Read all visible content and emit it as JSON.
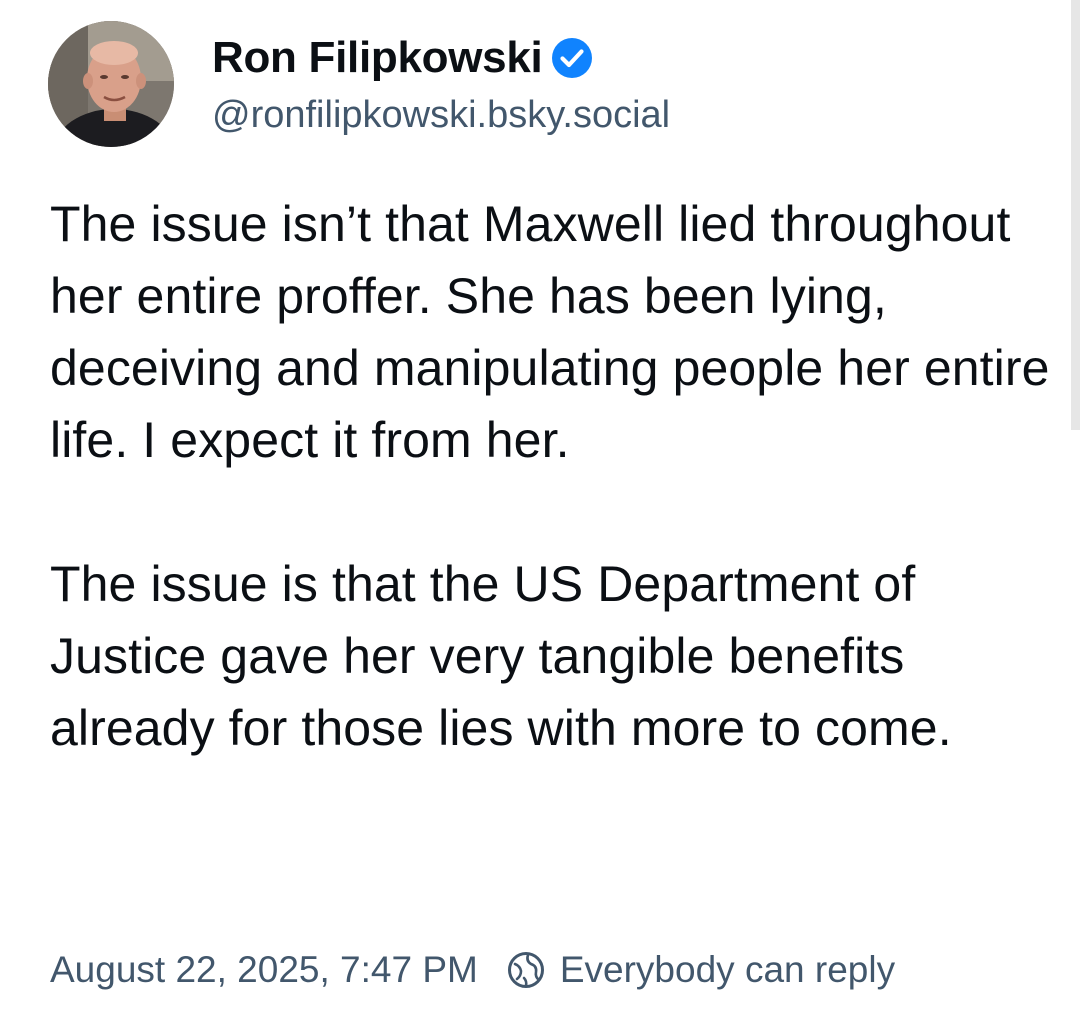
{
  "author": {
    "display_name": "Ron Filipkowski",
    "handle": "@ronfilipkowski.bsky.social",
    "verified": true,
    "verified_color": "#1083fe"
  },
  "post": {
    "text": "The issue isn’t that Maxwell lied throughout her entire proffer. She has been lying, deceiving and manipulating people her entire life. I expect it from her.\n\nThe issue is that the US Department of Justice gave her very tangible benefits already for those lies with more to come.",
    "timestamp": "August 22, 2025, 7:47 PM",
    "reply_setting": "Everybody can reply",
    "reply_icon": "globe-icon"
  },
  "colors": {
    "text": "#0b0f14",
    "secondary": "#42576c",
    "background": "#ffffff"
  }
}
